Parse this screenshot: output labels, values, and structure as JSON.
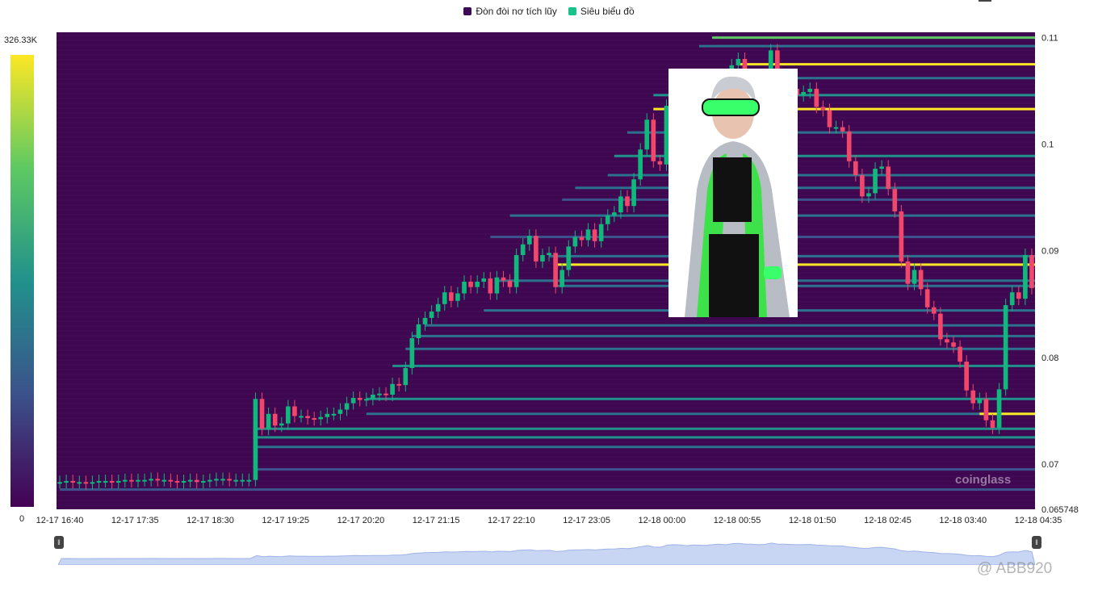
{
  "legend": {
    "items": [
      {
        "label": "Đòn đòi nơ tích lũy",
        "color": "#3c0a55"
      },
      {
        "label": "Siêu biểu đồ",
        "color": "#19c28a"
      }
    ]
  },
  "colorbar": {
    "max_label": "326.33K",
    "min_label": "0"
  },
  "watermark": "coinglass",
  "credit": "@ ABB920",
  "colors": {
    "background": "#3e0750",
    "up": "#10b87c",
    "down": "#f0476a",
    "high_level": "#fde725"
  },
  "chart_data": {
    "type": "heatmap",
    "series_name": "Candles",
    "x_tick_labels": [
      "12-17 16:40",
      "12-17 17:35",
      "12-17 18:30",
      "12-17 19:25",
      "12-17 20:20",
      "12-17 21:15",
      "12-17 22:10",
      "12-17 23:05",
      "12-18 00:00",
      "12-18 00:55",
      "12-18 01:50",
      "12-18 02:45",
      "12-18 03:40",
      "12-18 04:35"
    ],
    "y_tick_labels": [
      "0.11",
      "0.1",
      "0.09",
      "0.08",
      "0.07",
      "0.065748"
    ],
    "ylim": [
      0.065748,
      0.1105
    ],
    "grid": false,
    "closes": [
      0.0683,
      0.0684,
      0.0683,
      0.0683,
      0.0682,
      0.0683,
      0.0684,
      0.0684,
      0.0683,
      0.0684,
      0.0685,
      0.0684,
      0.0685,
      0.0685,
      0.0686,
      0.0685,
      0.0685,
      0.0684,
      0.0683,
      0.0684,
      0.0685,
      0.0683,
      0.0684,
      0.0685,
      0.0686,
      0.0686,
      0.0685,
      0.0685,
      0.0685,
      0.0685,
      0.0761,
      0.0733,
      0.0747,
      0.0736,
      0.0738,
      0.0754,
      0.0745,
      0.0745,
      0.0743,
      0.0742,
      0.0744,
      0.0747,
      0.0747,
      0.0751,
      0.0757,
      0.0762,
      0.076,
      0.0761,
      0.0765,
      0.0766,
      0.0765,
      0.0775,
      0.0774,
      0.079,
      0.0818,
      0.0831,
      0.0837,
      0.0843,
      0.085,
      0.0861,
      0.0853,
      0.086,
      0.0871,
      0.0866,
      0.0871,
      0.0874,
      0.086,
      0.0875,
      0.0872,
      0.0866,
      0.0896,
      0.0906,
      0.0914,
      0.089,
      0.0896,
      0.0898,
      0.0866,
      0.0882,
      0.0904,
      0.0913,
      0.091,
      0.092,
      0.0909,
      0.0925,
      0.0933,
      0.0936,
      0.0951,
      0.0942,
      0.0967,
      0.0995,
      0.1023,
      0.0984,
      0.0981,
      0.1036,
      0.1047,
      0.1042,
      0.1022,
      0.1041,
      0.1033,
      0.1028,
      0.105,
      0.1062,
      0.1045,
      0.1074,
      0.108,
      0.1064,
      0.106,
      0.1046,
      0.1055,
      0.1088,
      0.1063,
      0.1062,
      0.1052,
      0.1046,
      0.1049,
      0.1052,
      0.1035,
      0.1032,
      0.1016,
      0.1016,
      0.1012,
      0.0984,
      0.0971,
      0.0951,
      0.0954,
      0.0977,
      0.0979,
      0.0958,
      0.0937,
      0.089,
      0.0869,
      0.0882,
      0.0864,
      0.0847,
      0.0841,
      0.0817,
      0.0814,
      0.081,
      0.0796,
      0.0769,
      0.0757,
      0.0761,
      0.0741,
      0.0734,
      0.077,
      0.0849,
      0.0861,
      0.0855,
      0.0896,
      0.0865
    ],
    "liquidation_levels": [
      {
        "price": 0.11,
        "start_index": 100,
        "intensity": 0.85
      },
      {
        "price": 0.1092,
        "start_index": 98,
        "intensity": 0.45
      },
      {
        "price": 0.1075,
        "start_index": 104,
        "intensity": 0.98
      },
      {
        "price": 0.1062,
        "start_index": 96,
        "intensity": 0.5
      },
      {
        "price": 0.1046,
        "start_index": 91,
        "intensity": 0.55
      },
      {
        "price": 0.1033,
        "start_index": 91,
        "intensity": 0.97
      },
      {
        "price": 0.1011,
        "start_index": 87,
        "intensity": 0.45
      },
      {
        "price": 0.0989,
        "start_index": 85,
        "intensity": 0.55
      },
      {
        "price": 0.0971,
        "start_index": 84,
        "intensity": 0.5
      },
      {
        "price": 0.0959,
        "start_index": 79,
        "intensity": 0.45
      },
      {
        "price": 0.0948,
        "start_index": 77,
        "intensity": 0.4
      },
      {
        "price": 0.0933,
        "start_index": 69,
        "intensity": 0.45
      },
      {
        "price": 0.0913,
        "start_index": 66,
        "intensity": 0.4
      },
      {
        "price": 0.0895,
        "start_index": 75,
        "intensity": 0.45
      },
      {
        "price": 0.0887,
        "start_index": 76,
        "intensity": 0.97
      },
      {
        "price": 0.0872,
        "start_index": 67,
        "intensity": 0.5
      },
      {
        "price": 0.0867,
        "start_index": 76,
        "intensity": 0.5
      },
      {
        "price": 0.0844,
        "start_index": 65,
        "intensity": 0.45
      },
      {
        "price": 0.083,
        "start_index": 56,
        "intensity": 0.5
      },
      {
        "price": 0.082,
        "start_index": 54,
        "intensity": 0.5
      },
      {
        "price": 0.0808,
        "start_index": 53,
        "intensity": 0.5
      },
      {
        "price": 0.0792,
        "start_index": 51,
        "intensity": 0.55
      },
      {
        "price": 0.0761,
        "start_index": 47,
        "intensity": 0.55
      },
      {
        "price": 0.0747,
        "start_index": 47,
        "intensity": 0.5
      },
      {
        "price": 0.0747,
        "start_index": 141,
        "intensity": 0.97
      },
      {
        "price": 0.0733,
        "start_index": 30,
        "intensity": 0.55
      },
      {
        "price": 0.0725,
        "start_index": 30,
        "intensity": 0.6
      },
      {
        "price": 0.0716,
        "start_index": 30,
        "intensity": 0.45
      },
      {
        "price": 0.0695,
        "start_index": 30,
        "intensity": 0.35
      },
      {
        "price": 0.0676,
        "start_index": 0,
        "intensity": 0.4
      }
    ]
  }
}
